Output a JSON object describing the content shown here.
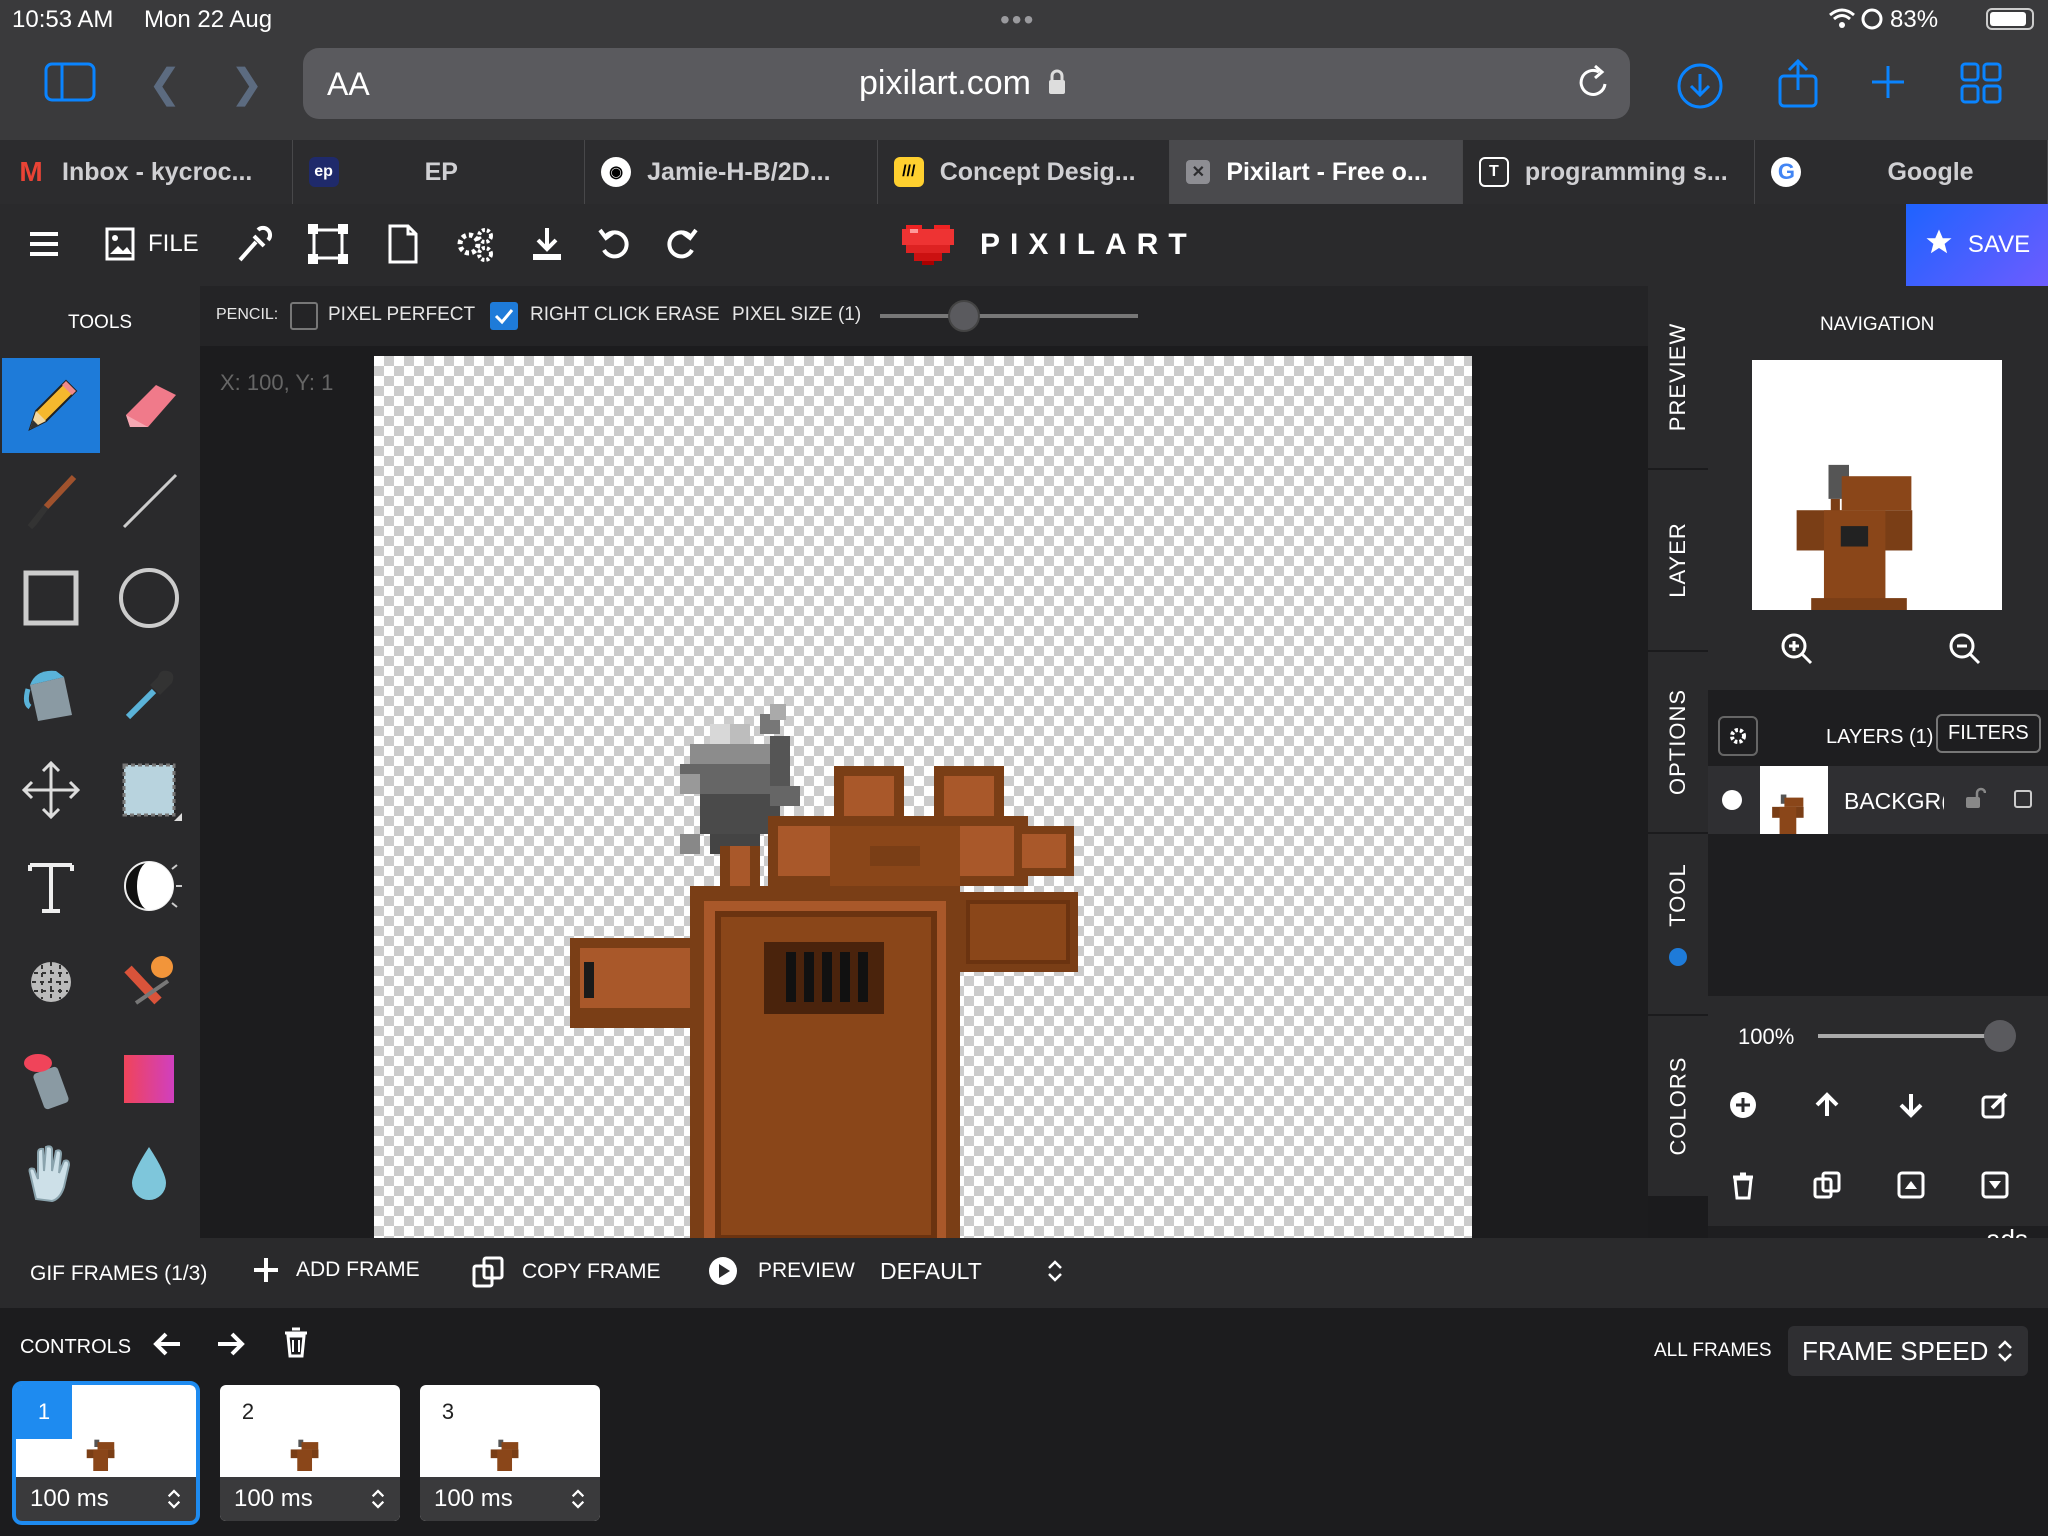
{
  "status": {
    "time": "10:53 AM",
    "date": "Mon 22 Aug",
    "battery": "83%"
  },
  "browser": {
    "url": "pixilart.com",
    "text_size": "AA"
  },
  "tabs": [
    {
      "label": "Inbox - kycroc...",
      "icon": "gmail-icon"
    },
    {
      "label": "EP",
      "icon": "ep-icon"
    },
    {
      "label": "Jamie-H-B/2D...",
      "icon": "github-icon"
    },
    {
      "label": "Concept Desig...",
      "icon": "miro-icon"
    },
    {
      "label": "Pixilart - Free o...",
      "icon": "close-icon"
    },
    {
      "label": "programming s...",
      "icon": "t-icon"
    },
    {
      "label": "Google",
      "icon": "google-icon"
    }
  ],
  "appbar": {
    "file_label": "FILE",
    "brand": "PIXILART",
    "save_label": "SAVE"
  },
  "tools": {
    "title": "TOOLS"
  },
  "options": {
    "tool": "PENCIL:",
    "pixel_perfect": "PIXEL PERFECT",
    "right_click_erase": "RIGHT CLICK ERASE",
    "pixel_size": "PIXEL SIZE (1)",
    "pixel_perfect_checked": false,
    "right_click_erase_checked": true
  },
  "canvas": {
    "coords": "X: 100, Y: 1"
  },
  "sidetabs": {
    "preview": "PREVIEW",
    "layer": "LAYER",
    "options": "OPTIONS",
    "tool": "TOOL",
    "colors": "COLORS"
  },
  "navigation": {
    "title": "NAVIGATION"
  },
  "layers": {
    "title": "LAYERS (1)",
    "filters": "FILTERS",
    "layer_name": "BACKGR(",
    "opacity": "100%"
  },
  "ads": "ads",
  "gif": {
    "frames_label": "GIF FRAMES (1/3)",
    "add_frame": "ADD FRAME",
    "copy_frame": "COPY FRAME",
    "preview": "PREVIEW",
    "mode": "DEFAULT"
  },
  "controls": {
    "label": "CONTROLS",
    "all_frames": "ALL FRAMES",
    "frame_speed": "FRAME SPEED"
  },
  "frames": [
    {
      "num": "1",
      "speed": "100 ms"
    },
    {
      "num": "2",
      "speed": "100 ms"
    },
    {
      "num": "3",
      "speed": "100 ms"
    }
  ]
}
